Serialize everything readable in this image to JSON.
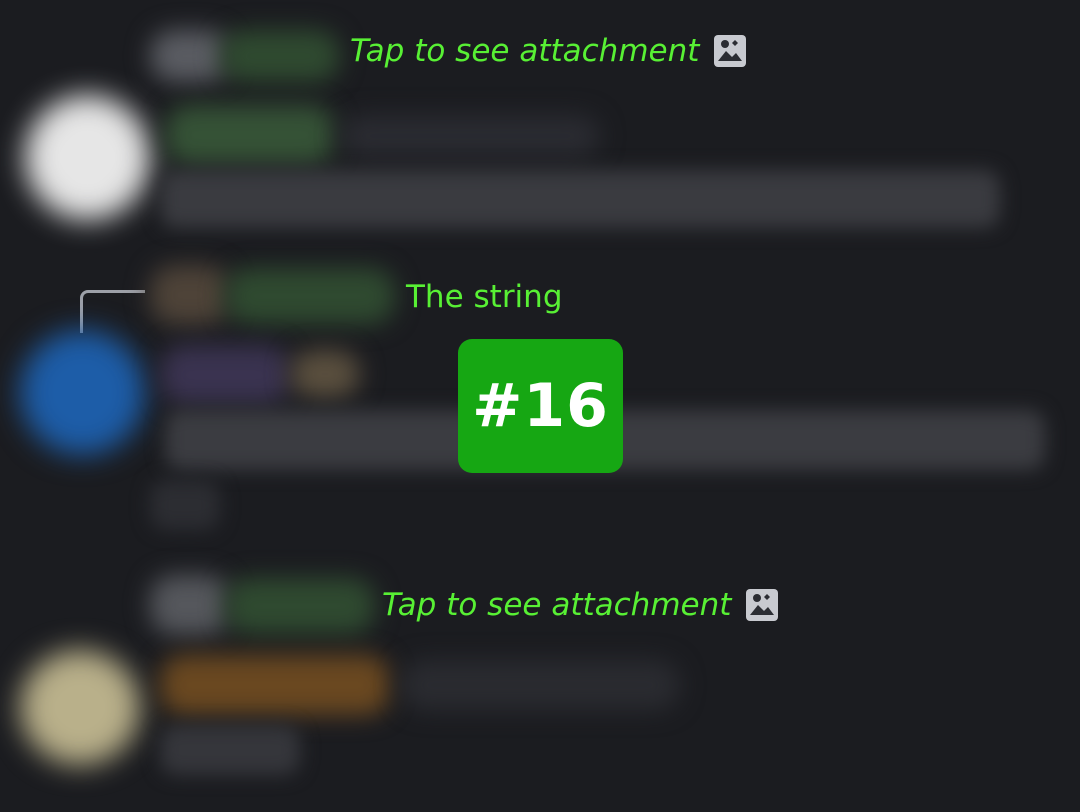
{
  "messages": [
    {
      "reply_text": "Tap to see attachment",
      "reply_icon": "image-icon"
    },
    {
      "reply_text": "The string"
    },
    {
      "reply_text": "Tap to see attachment",
      "reply_icon": "image-icon"
    }
  ],
  "badge": {
    "label": "#16",
    "color": "#16a713"
  },
  "colors": {
    "background": "#1b1c20",
    "reply_text": "#58f034",
    "icon": "#c8cad0"
  }
}
